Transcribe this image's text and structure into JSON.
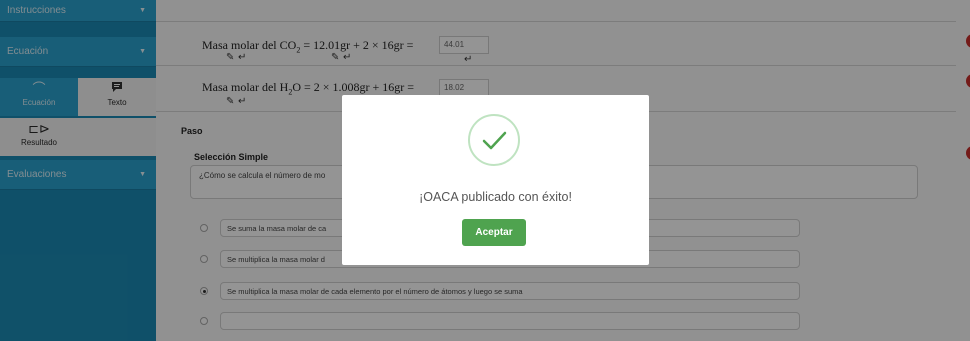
{
  "sidebar": {
    "instrucciones": "Instrucciones",
    "ecuacion": "Ecuación",
    "evaluaciones": "Evaluaciones",
    "tools": {
      "ecuacion": "Ecuación",
      "texto": "Texto",
      "resultado": "Resultado"
    }
  },
  "main": {
    "eq1": {
      "prefix": "Masa  molar  del  CO",
      "sub": "2",
      "formula": " =  12.01gr + 2 × 16gr = ",
      "value": "44.01"
    },
    "eq2": {
      "prefix": "Masa  molar  del  H",
      "sub": "2",
      "formula": "O =  2 × 1.008gr + 16gr = ",
      "value": "18.02"
    },
    "paso": "Paso",
    "seleccion_title": "Selección Simple",
    "question": "¿Cómo se calcula el número de mo",
    "options": [
      {
        "text": "Se suma la masa molar de ca",
        "selected": false
      },
      {
        "text": "Se multiplica la masa molar d",
        "selected": false
      },
      {
        "text": "Se multiplica la masa molar de cada elemento por el número de átomos y luego se suma",
        "selected": true
      },
      {
        "text": "",
        "selected": false
      }
    ]
  },
  "modal": {
    "message": "¡OACA publicado con éxito!",
    "button": "Aceptar",
    "icon": "success-check-icon",
    "accent": "#4fa34f"
  }
}
